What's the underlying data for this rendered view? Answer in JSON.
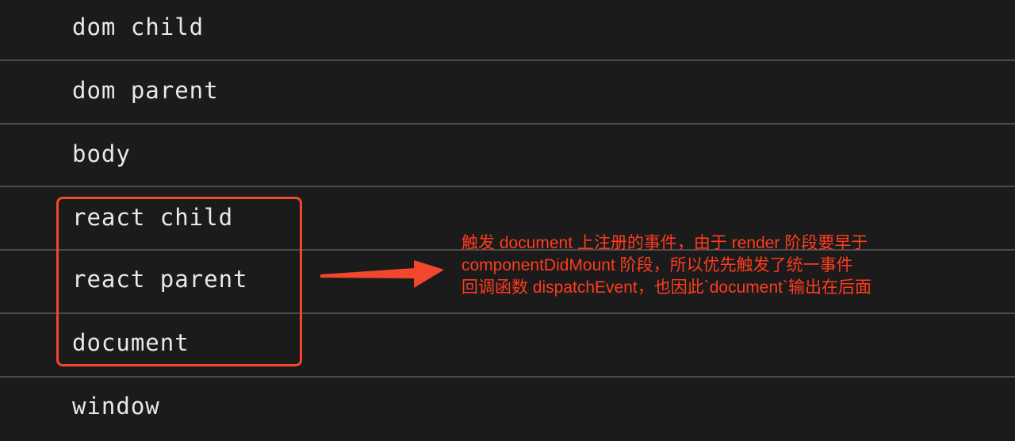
{
  "console": {
    "entries": [
      {
        "text": "dom child"
      },
      {
        "text": "dom parent"
      },
      {
        "text": "body"
      },
      {
        "text": "react child"
      },
      {
        "text": "react parent"
      },
      {
        "text": "document"
      },
      {
        "text": "window"
      }
    ]
  },
  "annotation": {
    "lines": [
      "触发 document 上注册的事件，由于 render 阶段要早于",
      "componentDidMount 阶段，所以优先触发了统一事件",
      "回调函数 dispatchEvent，也因此`document`输出在后面"
    ]
  },
  "colors": {
    "background": "#1b1b1b",
    "text": "#e9e9e9",
    "divider": "#4c4c4c",
    "accent": "#f2472d"
  }
}
